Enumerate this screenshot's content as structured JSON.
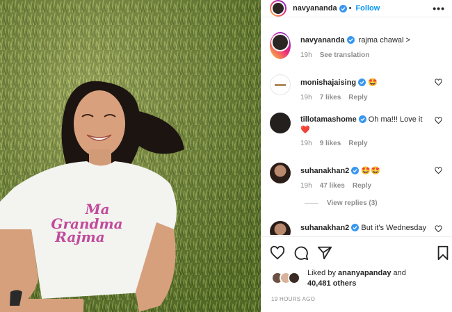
{
  "post": {
    "author": "navyananda",
    "follow_label": "Follow",
    "caption": "rajma chawal >",
    "caption_time": "19h",
    "see_translation": "See translation",
    "shirt_text": [
      "Ma",
      "Grandma",
      "Rajma"
    ]
  },
  "comments": [
    {
      "user": "monishajaising",
      "text": "🤩",
      "time": "19h",
      "likes": "7 likes",
      "reply": "Reply"
    },
    {
      "user": "tillotamashome",
      "text": "Oh ma!!! Love it",
      "text2": "❤️",
      "time": "19h",
      "likes": "9 likes",
      "reply": "Reply"
    },
    {
      "user": "suhanakhan2",
      "text": "🤩🤩",
      "time": "19h",
      "likes": "47 likes",
      "reply": "Reply"
    },
    {
      "user": "suhanakhan2",
      "text": "But it's Wednesday"
    }
  ],
  "view_replies": "View replies (3)",
  "liked_by": {
    "prefix": "Liked by",
    "user": "ananyapanday",
    "and": "and",
    "count": "40,481 others"
  },
  "timestamp": "19 HOURS AGO",
  "icons": [
    "heart-icon",
    "comment-icon",
    "share-icon",
    "bookmark-icon",
    "more-icon",
    "verified-icon"
  ]
}
